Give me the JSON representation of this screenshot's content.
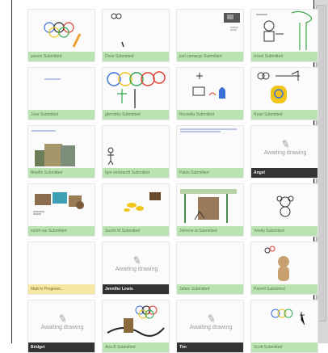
{
  "awaiting_text": "Awaiting drawing",
  "pencil_glyph": "✎",
  "cards": [
    {
      "caption": "yewen Submitted",
      "style": "green",
      "art": "olympic-rings"
    },
    {
      "caption": "Drew Submitted",
      "style": "green",
      "art": "sketch-dots"
    },
    {
      "caption": "joel camargo Submitted",
      "style": "green",
      "art": "photo-small"
    },
    {
      "caption": "Israel Submitted",
      "style": "green",
      "art": "stick-figure-tree"
    },
    {
      "caption": "Jose Submitted",
      "style": "green",
      "art": "blue-scribble"
    },
    {
      "caption": "gbrrobby Submitted",
      "style": "green",
      "art": "rings-figure"
    },
    {
      "caption": "Rossella Submitted",
      "style": "green",
      "art": "blue-drawing"
    },
    {
      "caption": "Ryan Submitted",
      "style": "green",
      "art": "yellow-figure"
    },
    {
      "caption": "Bluefin Submitted",
      "style": "green",
      "art": "photo-collage"
    },
    {
      "caption": "Igor verbrandt Submitted",
      "style": "green",
      "art": "stick-person"
    },
    {
      "caption": "Pablo Submitted",
      "style": "green",
      "art": "blue-text"
    },
    {
      "caption": "Angel",
      "style": "dark",
      "art": "awaiting"
    },
    {
      "caption": "sumit rao Submitted",
      "style": "green",
      "art": "photo-animals"
    },
    {
      "caption": "Sushil M Submitted",
      "style": "green",
      "art": "yellow-blobs"
    },
    {
      "caption": "Jolirene di Submitted",
      "style": "green",
      "art": "trees-photo"
    },
    {
      "caption": "Vendy Submitted",
      "style": "green",
      "art": "monkey"
    },
    {
      "caption": "Matt In Progress...",
      "style": "yellow",
      "art": "blank"
    },
    {
      "caption": "Jennifer Lewis",
      "style": "dark",
      "art": "awaiting"
    },
    {
      "caption": "Jafalo Submitted",
      "style": "green",
      "art": "blank"
    },
    {
      "caption": "Pawell Submitted",
      "style": "green",
      "art": "bear"
    },
    {
      "caption": "Bridget",
      "style": "dark",
      "art": "awaiting"
    },
    {
      "caption": "Ana B Submitted",
      "style": "green",
      "art": "rings-birds"
    },
    {
      "caption": "Tim",
      "style": "dark",
      "art": "awaiting"
    },
    {
      "caption": "Scott Submitted",
      "style": "green",
      "art": "rings-figure-small"
    }
  ],
  "colors": {
    "caption_green": "#b9e3b0",
    "caption_yellow": "#f6e7a4",
    "caption_dark": "#333333",
    "ring_blue": "#3a6fd8",
    "ring_red": "#e03a2e",
    "ring_yellow": "#f0c419",
    "ring_green": "#2fa84f"
  }
}
